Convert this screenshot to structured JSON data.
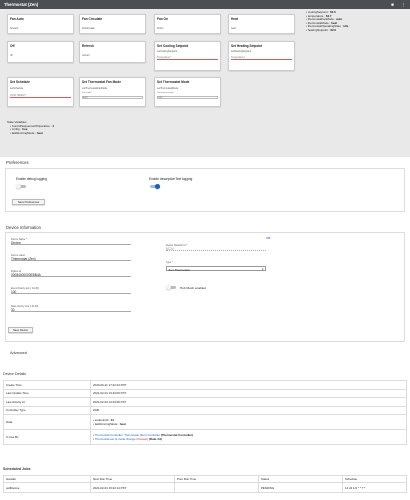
{
  "window": {
    "title": "Thermostat (Zen)"
  },
  "commands": {
    "row1": [
      {
        "title": "Fan Auto",
        "name": "fanAuto"
      },
      {
        "title": "Fan Circulate",
        "name": "fanCirculate"
      },
      {
        "title": "Fan On",
        "name": "fanOn"
      },
      {
        "title": "Heat",
        "name": "heat"
      }
    ],
    "row2": [
      {
        "title": "Off",
        "name": "off"
      },
      {
        "title": "Refresh",
        "name": "refresh"
      },
      {
        "title": "Set Cooling Setpoint",
        "name": "setCoolingSetpoint",
        "placeholder": "Temperature*"
      },
      {
        "title": "Set Heating Setpoint",
        "name": "setHeatingSetpoint",
        "placeholder": "Temperature*"
      }
    ],
    "row3": [
      {
        "title": "Set Schedule",
        "name": "setSchedule",
        "input": "JSON OBJECT"
      },
      {
        "title": "Set Thermostat Fan Mode",
        "name": "setThermostatFanMode",
        "label": "Fan mode*",
        "input": "auto"
      },
      {
        "title": "Set Thermostat Mode",
        "name": "setThermostatMode",
        "label": "Thermostat mode*",
        "input": "cool"
      }
    ]
  },
  "current_states": [
    {
      "key": "coolingSetpoint",
      "value": "62.6"
    },
    {
      "key": "temperature",
      "value": "63.7"
    },
    {
      "key": "thermostatFanMode",
      "value": "auto"
    },
    {
      "key": "thermostatMode",
      "value": "heat"
    },
    {
      "key": "thermostatOperatingState",
      "value": "idle"
    },
    {
      "key": "heatingSetpoint",
      "value": "62.6"
    }
  ],
  "state_variables": {
    "heading": "State Variables",
    "items": [
      {
        "key": "ControlSequenceOfOperation",
        "value": "4"
      },
      {
        "key": "config",
        "value": "true"
      },
      {
        "key": "lastRunningMode",
        "value": "heat"
      }
    ]
  },
  "preferences": {
    "heading": "Preferences",
    "debug_label": "Enable debug logging",
    "desc_label": "Enable descriptionText logging",
    "debug_on": false,
    "desc_on": true,
    "save_label": "Save Preferences"
  },
  "device_info": {
    "heading": "Device Information",
    "id_link": "485",
    "name_label": "Device Name *",
    "name_value": "Device",
    "label_label": "Device Label",
    "label_value": "Thermostat (Zen)",
    "network_label": "Device Network Id *",
    "network_value": "6C24",
    "zigbee_label": "Zigbee Id",
    "zigbee_value": "00084000000EBB4A",
    "type_label": "Type *",
    "type_value": "Zen Thermostat",
    "history_label": "Event history size ( 10-30)",
    "history_value": "100",
    "states_label": "State history size ( 10-30)",
    "states_value": "30",
    "mesh_label": "Hub Mesh enabled",
    "mesh_on": false,
    "save_label": "Save Device"
  },
  "advanced": {
    "heading": "Advanced"
  },
  "device_details": {
    "heading": "Device Details",
    "rows": [
      {
        "label": "Create Time",
        "value": "2020-06-21 17:22:24 PDT"
      },
      {
        "label": "Last Update Time",
        "value": "2021-02-04 13:43:06 PST"
      },
      {
        "label": "Last Activity At",
        "value": "2021-02-04 13:43:06 PST"
      },
      {
        "label": "Controller Type",
        "value": "ZGB"
      }
    ],
    "data_label": "Data",
    "data_lines": [
      {
        "key": "endpointId",
        "value": "01"
      },
      {
        "key": "lastRunningMode",
        "value": "heat"
      }
    ],
    "inuse_label": "In Use By",
    "inuse_lines": [
      {
        "name": "Thermostat Controller: Thermostat (Zen) Controller",
        "extra": "(Thermostat Controller)"
      },
      {
        "name": "Thermostat set pt mode change",
        "paused": "(Paused)",
        "extra": "(Rule-4.0)"
      }
    ]
  },
  "scheduled_jobs": {
    "heading": "Scheduled Jobs",
    "columns": [
      "Handler",
      "Next Run Time",
      "Prev Run Time",
      "Status",
      "Schedule"
    ],
    "rows": [
      {
        "handler": "pollDevice",
        "next": "2021-02-04 15:22:14 PST",
        "prev": "",
        "status": "PENDING",
        "schedule": "14 22 1/2 * * ? *"
      }
    ]
  },
  "colors": {
    "accent": "#1a5fb4",
    "topbar": "#4b4f54",
    "toggle_on": "#1a5fb4"
  }
}
